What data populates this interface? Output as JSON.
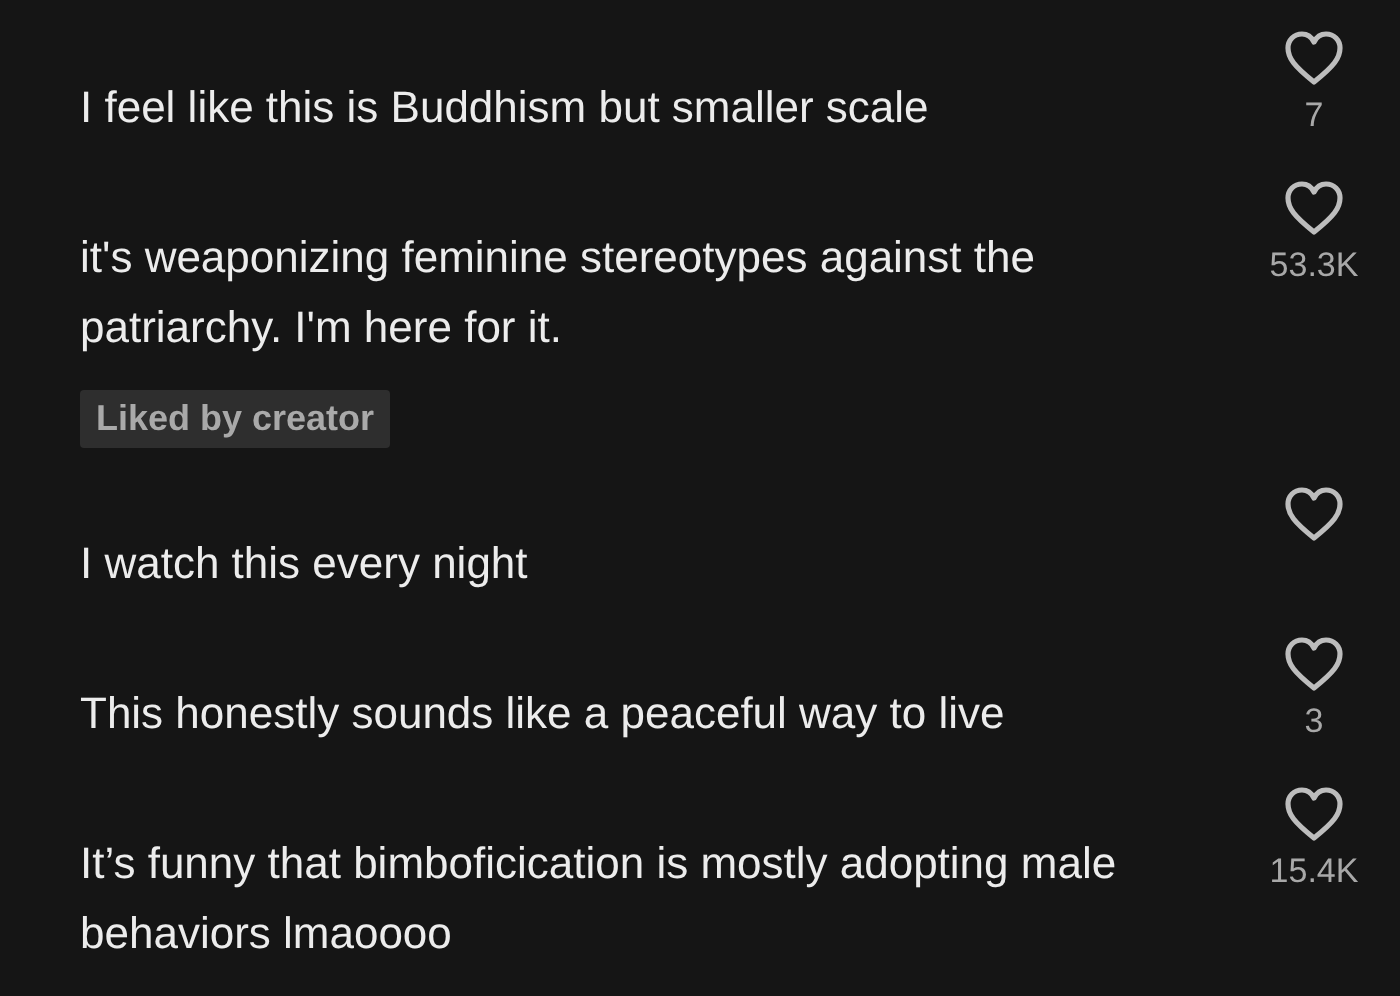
{
  "comments": [
    {
      "text": "I feel like this is Buddhism but smaller scale",
      "likes": "7"
    },
    {
      "text": "it's weaponizing feminine stereotypes against the patriarchy. I'm here for it.",
      "likes": "53.3K",
      "badge": "Liked by creator"
    },
    {
      "text": "I watch this every night"
    },
    {
      "text": "This honestly sounds like a peaceful way to live",
      "likes": "3"
    },
    {
      "text": "It’s funny that bimboficication is mostly adopting male behaviors lmaoooo",
      "likes": "15.4K"
    }
  ]
}
